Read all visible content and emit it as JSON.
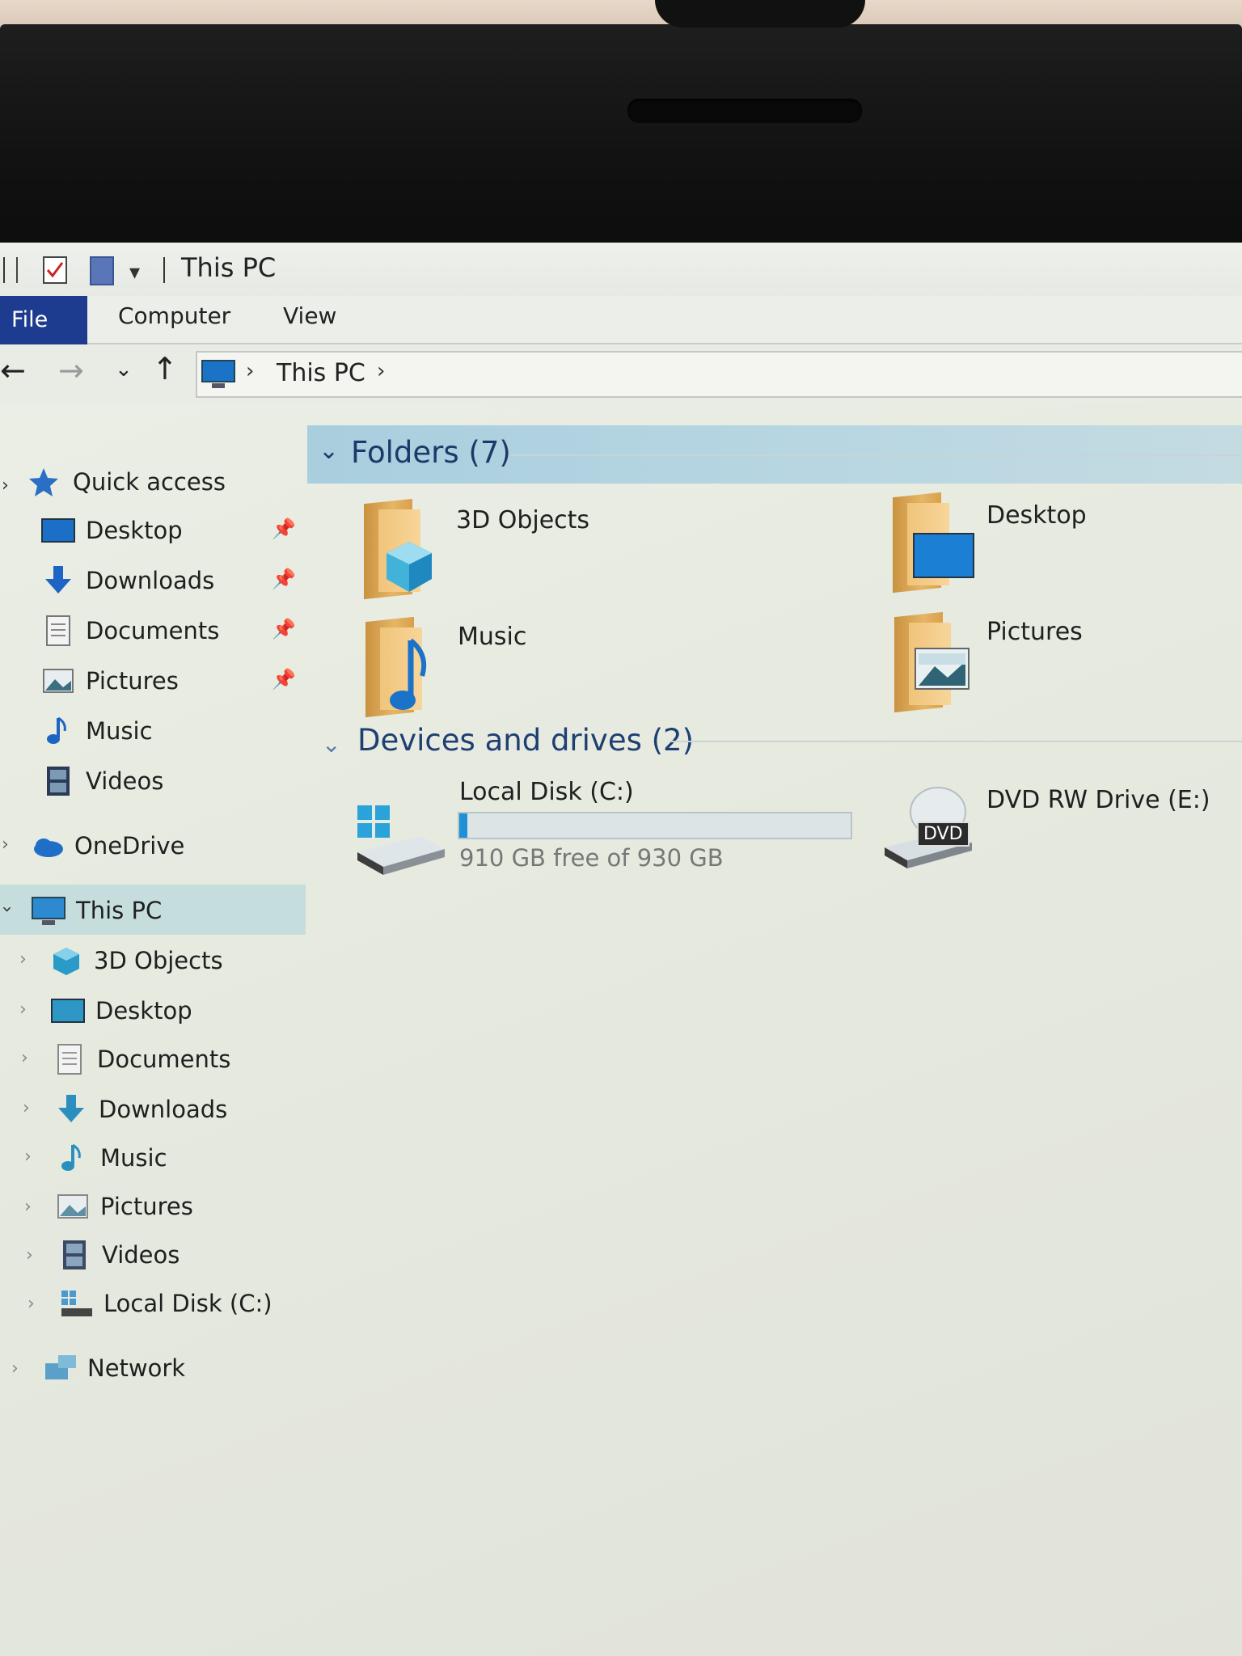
{
  "window": {
    "title": "This PC"
  },
  "ribbon": {
    "tabs": [
      "File",
      "Computer",
      "View"
    ]
  },
  "address": {
    "path": [
      "This PC"
    ]
  },
  "sidebar": {
    "quick_access": {
      "label": "Quick access",
      "items": [
        {
          "label": "Desktop",
          "icon": "desktop-icon",
          "pinned": true
        },
        {
          "label": "Downloads",
          "icon": "downloads-icon",
          "pinned": true
        },
        {
          "label": "Documents",
          "icon": "documents-icon",
          "pinned": true
        },
        {
          "label": "Pictures",
          "icon": "pictures-icon",
          "pinned": true
        },
        {
          "label": "Music",
          "icon": "music-icon",
          "pinned": false
        },
        {
          "label": "Videos",
          "icon": "videos-icon",
          "pinned": false
        }
      ]
    },
    "onedrive": {
      "label": "OneDrive",
      "icon": "onedrive-icon"
    },
    "this_pc": {
      "label": "This PC",
      "icon": "this-pc-icon",
      "items": [
        {
          "label": "3D Objects",
          "icon": "3d-objects-icon"
        },
        {
          "label": "Desktop",
          "icon": "desktop-icon"
        },
        {
          "label": "Documents",
          "icon": "documents-icon"
        },
        {
          "label": "Downloads",
          "icon": "downloads-icon"
        },
        {
          "label": "Music",
          "icon": "music-icon"
        },
        {
          "label": "Pictures",
          "icon": "pictures-icon"
        },
        {
          "label": "Videos",
          "icon": "videos-icon"
        },
        {
          "label": "Local Disk (C:)",
          "icon": "local-disk-icon"
        }
      ]
    },
    "network": {
      "label": "Network",
      "icon": "network-icon"
    }
  },
  "main": {
    "folders_group": {
      "label": "Folders (7)"
    },
    "folders": [
      {
        "label": "3D Objects",
        "icon": "3d-objects-icon"
      },
      {
        "label": "Desktop",
        "icon": "desktop-icon"
      },
      {
        "label": "Music",
        "icon": "music-icon"
      },
      {
        "label": "Pictures",
        "icon": "pictures-icon"
      }
    ],
    "drives_group": {
      "label": "Devices and drives (2)"
    },
    "drives": [
      {
        "label": "Local Disk (C:)",
        "icon": "local-disk-icon",
        "free": "910 GB free of 930 GB",
        "used_fraction": 0.0215
      },
      {
        "label": "DVD RW Drive (E:)",
        "icon": "dvd-drive-icon",
        "badge": "DVD"
      }
    ]
  },
  "colors": {
    "accent": "#1d3b8f",
    "selection": "#c6ddde",
    "group_header": "#a9cede",
    "drive_bar": "#1f8fd6"
  }
}
